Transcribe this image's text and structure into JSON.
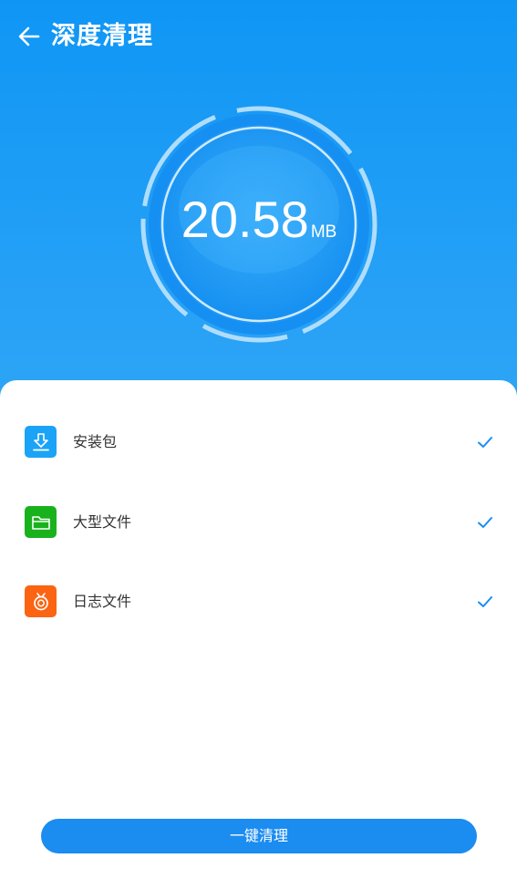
{
  "header": {
    "title": "深度清理"
  },
  "gauge": {
    "value": "20.58",
    "unit": "MB"
  },
  "items": [
    {
      "label": "安装包",
      "icon": "download-icon",
      "icon_color": "#1aa3f7",
      "checked": true
    },
    {
      "label": "大型文件",
      "icon": "folder-icon",
      "icon_color": "#19b21d",
      "checked": true
    },
    {
      "label": "日志文件",
      "icon": "log-icon",
      "icon_color": "#fa6412",
      "checked": true
    }
  ],
  "action": {
    "label": "一键清理"
  },
  "colors": {
    "primary": "#1b8cf0",
    "header_gradient_top": "#0f96f5",
    "check": "#1b8cf0"
  }
}
